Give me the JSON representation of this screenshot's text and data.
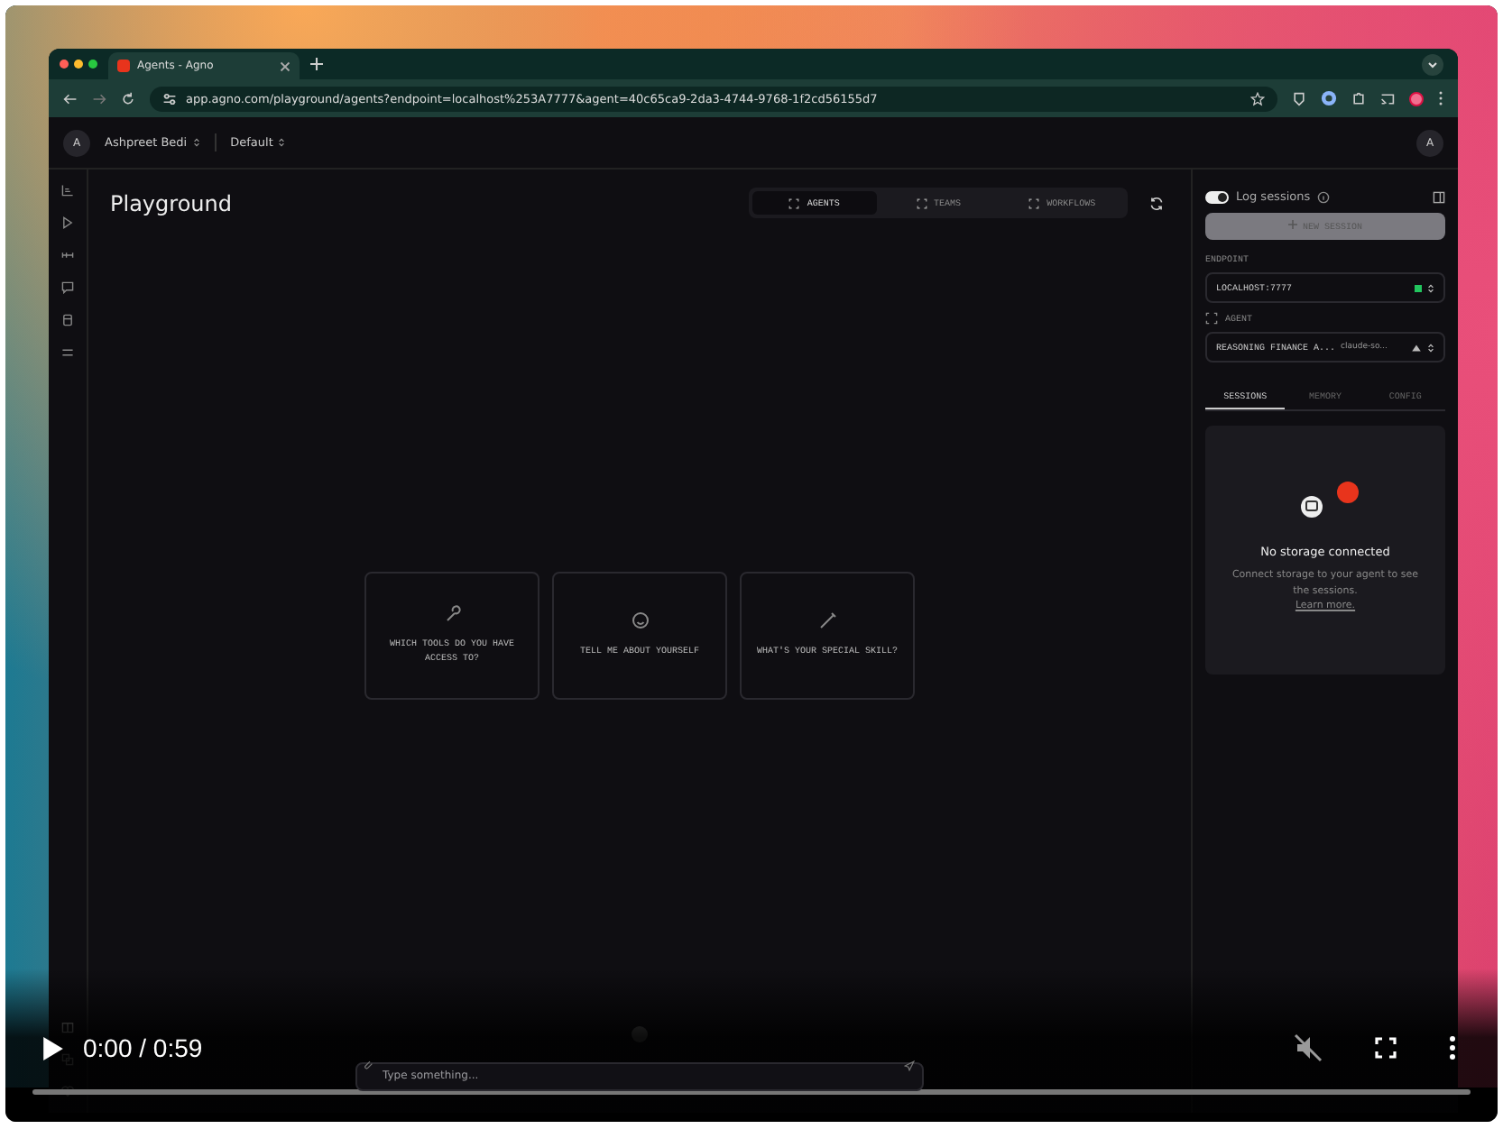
{
  "browser": {
    "tab_title": "Agents - Agno",
    "url": "app.agno.com/playground/agents?endpoint=localhost%253A7777&agent=40c65ca9-2da3-4744-9768-1f2cd56155d7"
  },
  "header": {
    "avatar": "A",
    "user": "Ashpreet Bedi",
    "workspace": "Default",
    "account_avatar": "A"
  },
  "title": "Playground",
  "mode_tabs": [
    {
      "label": "AGENTS",
      "selected": true
    },
    {
      "label": "TEAMS",
      "selected": false
    },
    {
      "label": "WORKFLOWS",
      "selected": false
    }
  ],
  "prompts": [
    {
      "kind": "tools",
      "text": "WHICH TOOLS DO YOU HAVE ACCESS TO?"
    },
    {
      "kind": "about",
      "text": "TELL ME ABOUT YOURSELF"
    },
    {
      "kind": "skill",
      "text": "WHAT'S YOUR SPECIAL SKILL?"
    }
  ],
  "chat_input": {
    "placeholder": "Type something..."
  },
  "sidebar": {
    "log_sessions": {
      "label": "Log sessions",
      "on": true
    },
    "new_session": {
      "label": "NEW SESSION",
      "disabled": true
    },
    "endpoint_label": "ENDPOINT",
    "endpoint": "LOCALHOST:7777",
    "endpoint_connected": true,
    "agent_label": "AGENT",
    "agent": "REASONING FINANCE A...",
    "model": "claude-so...",
    "tabs": [
      {
        "label": "SESSIONS",
        "selected": true
      },
      {
        "label": "MEMORY",
        "selected": false
      },
      {
        "label": "CONFIG",
        "selected": false
      }
    ],
    "empty": {
      "title": "No storage connected",
      "text": "Connect storage to your agent to see the sessions.",
      "link": "Learn more."
    }
  },
  "video": {
    "time": "0:00 / 0:59",
    "muted": true,
    "level": 0
  }
}
